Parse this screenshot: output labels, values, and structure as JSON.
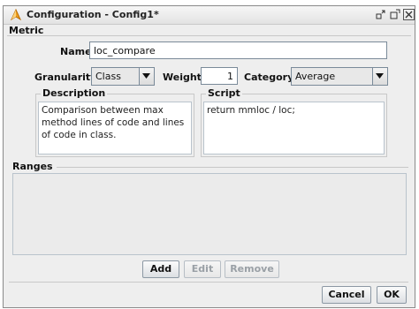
{
  "window": {
    "title": "Configuration - Config1*",
    "icon": "compass-icon"
  },
  "metric": {
    "group_label": "Metric",
    "name_label": "Name:",
    "name_value": "loc_compare",
    "granularity_label": "Granularity:",
    "granularity_value": "Class",
    "weight_label": "Weight:",
    "weight_value": "1",
    "category_label": "Category:",
    "category_value": "Average",
    "description_title": "Description",
    "description_text": "Comparison between max method lines of code and lines of code in class.",
    "script_title": "Script",
    "script_text": "return mmloc / loc;"
  },
  "ranges": {
    "title": "Ranges",
    "add_label": "Add",
    "edit_label": "Edit",
    "remove_label": "Remove"
  },
  "footer": {
    "cancel_label": "Cancel",
    "ok_label": "OK"
  }
}
